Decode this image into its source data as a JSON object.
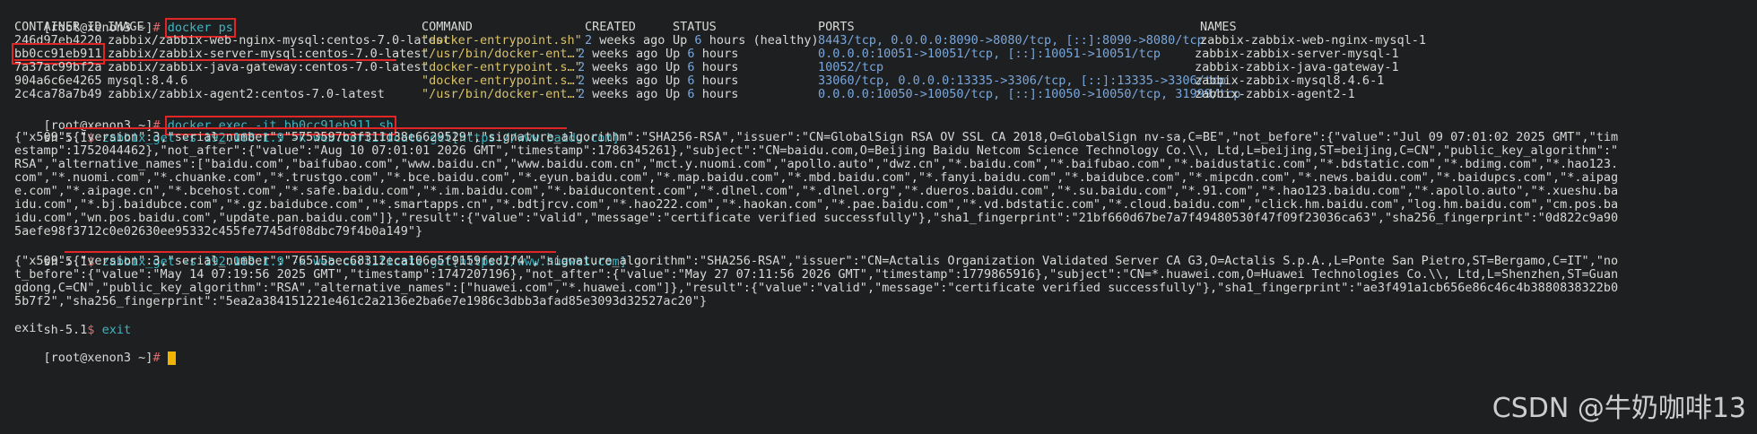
{
  "prompt": {
    "user_host": "[root@xenon3 ~]",
    "hash": "#"
  },
  "sh_prompt": {
    "text": "sh-5.1",
    "sign": "$"
  },
  "cmd_docker_ps": "docker ps",
  "header": {
    "container_id": "CONTAINER ID",
    "image": "IMAGE",
    "command": "COMMAND",
    "created": "CREATED",
    "status": "STATUS",
    "ports": "PORTS",
    "names": "NAMES"
  },
  "rows": [
    {
      "id": "246d97eb4220",
      "image": "zabbix/zabbix-web-nginx-mysql:centos-7.0-latest",
      "command": "\"docker-entrypoint.sh\"",
      "created_num": "2",
      "created": "weeks ago",
      "status_prefix": "Up",
      "status_num": "6",
      "status_rest": "hours (healthy)",
      "ports": "8443/tcp, 0.0.0.0:8090->8080/tcp, [::]:8090->8080/tcp",
      "name": "zabbix-zabbix-web-nginx-mysql-1"
    },
    {
      "id": "bb0cc91eb911",
      "image": "zabbix/zabbix-server-mysql:centos-7.0-latest",
      "command": "\"/usr/bin/docker-ent…\"",
      "created_num": "2",
      "created": "weeks ago",
      "status_prefix": "Up",
      "status_num": "6",
      "status_rest": "hours",
      "ports": "0.0.0.0:10051->10051/tcp, [::]:10051->10051/tcp",
      "name": "zabbix-zabbix-server-mysql-1"
    },
    {
      "id": "7a37ac99bf2a",
      "image": "zabbix/zabbix-java-gateway:centos-7.0-latest",
      "command": "\"docker-entrypoint.s…\"",
      "created_num": "2",
      "created": "weeks ago",
      "status_prefix": "Up",
      "status_num": "6",
      "status_rest": "hours",
      "ports": "10052/tcp",
      "name": "zabbix-zabbix-java-gateway-1"
    },
    {
      "id": "904a6c6e4265",
      "image": "mysql:8.4.6",
      "command": "\"docker-entrypoint.s…\"",
      "created_num": "2",
      "created": "weeks ago",
      "status_prefix": "Up",
      "status_num": "6",
      "status_rest": "hours",
      "ports": "33060/tcp, 0.0.0.0:13335->3306/tcp, [::]:13335->3306/tcp",
      "name": "zabbix-zabbix-mysql8.4.6-1"
    },
    {
      "id": "2c4ca78a7b49",
      "image": "zabbix/zabbix-agent2:centos-7.0-latest",
      "command": "\"/usr/bin/docker-ent…\"",
      "created_num": "2",
      "created": "weeks ago",
      "status_prefix": "Up",
      "status_num": "6",
      "status_rest": "hours",
      "ports": "0.0.0.0:10050->10050/tcp, [::]:10050->10050/tcp, 31999/tcp",
      "name": "zabbix-zabbix-agent2-1"
    }
  ],
  "cmd_exec": "docker exec -it bb0cc91eb911 sh",
  "zabbix_get_1": "zabbix_get -s 192.168.1.9 -k web.certificate.get[https://www.baidu.com]",
  "output_baidu": [
    "{\"x509\":{\"version\":3,\"serial_number\":\"5753597b3f311d38e6629529\",\"signature_algorithm\":\"SHA256-RSA\",\"issuer\":\"CN=GlobalSign RSA OV SSL CA 2018,O=GlobalSign nv-sa,C=BE\",\"not_before\":{\"value\":\"Jul 09 07:01:02 2025 GMT\",\"tim",
    "estamp\":1752044462},\"not_after\":{\"value\":\"Aug 10 07:01:01 2026 GMT\",\"timestamp\":1786345261},\"subject\":\"CN=baidu.com,O=Beijing Baidu Netcom Science Technology Co.\\\\, Ltd,L=beijing,ST=beijing,C=CN\",\"public_key_algorithm\":\"",
    "RSA\",\"alternative_names\":[\"baidu.com\",\"baifubao.com\",\"www.baidu.cn\",\"www.baidu.com.cn\",\"mct.y.nuomi.com\",\"apollo.auto\",\"dwz.cn\",\"*.baidu.com\",\"*.baifubao.com\",\"*.baidustatic.com\",\"*.bdstatic.com\",\"*.bdimg.com\",\"*.hao123.",
    "com\",\"*.nuomi.com\",\"*.chuanke.com\",\"*.trustgo.com\",\"*.bce.baidu.com\",\"*.eyun.baidu.com\",\"*.map.baidu.com\",\"*.mbd.baidu.com\",\"*.fanyi.baidu.com\",\"*.baidubce.com\",\"*.mipcdn.com\",\"*.news.baidu.com\",\"*.baidupcs.com\",\"*.aipag",
    "e.com\",\"*.aipage.cn\",\"*.bcehost.com\",\"*.safe.baidu.com\",\"*.im.baidu.com\",\"*.baiducontent.com\",\"*.dlnel.com\",\"*.dlnel.org\",\"*.dueros.baidu.com\",\"*.su.baidu.com\",\"*.91.com\",\"*.hao123.baidu.com\",\"*.apollo.auto\",\"*.xueshu.ba",
    "idu.com\",\"*.bj.baidubce.com\",\"*.gz.baidubce.com\",\"*.smartapps.cn\",\"*.bdtjrcv.com\",\"*.hao222.com\",\"*.haokan.com\",\"*.pae.baidu.com\",\"*.vd.bdstatic.com\",\"*.cloud.baidu.com\",\"click.hm.baidu.com\",\"log.hm.baidu.com\",\"cm.pos.ba",
    "idu.com\",\"wn.pos.baidu.com\",\"update.pan.baidu.com\"]},\"result\":{\"value\":\"valid\",\"message\":\"certificate verified successfully\"},\"sha1_fingerprint\":\"21bf660d67be7a7f49480530f47f09f23036ca63\",\"sha256_fingerprint\":\"0d822c9a90",
    "5aefe98f3712c0e02630ee95332c455fe7745df08dbc79f4b0a149\"}"
  ],
  "zabbix_get_2": "zabbix_get -s 192.168.1.9 -k web.certificate.get[https://www.huawei.com]",
  "output_huawei": [
    "{\"x509\":{\"version\":3,\"serial_number\":\"76515aec68312eca106e5f9159fed1f4\",\"signature_algorithm\":\"SHA256-RSA\",\"issuer\":\"CN=Actalis Organization Validated Server CA G3,O=Actalis S.p.A.,L=Ponte San Pietro,ST=Bergamo,C=IT\",\"no",
    "t_before\":{\"value\":\"May 14 07:19:56 2025 GMT\",\"timestamp\":1747207196},\"not_after\":{\"value\":\"May 27 07:11:56 2026 GMT\",\"timestamp\":1779865916},\"subject\":\"CN=*.huawei.com,O=Huawei Technologies Co.\\\\, Ltd,L=Shenzhen,ST=Guan",
    "gdong,C=CN\",\"public_key_algorithm\":\"RSA\",\"alternative_names\":[\"huawei.com\",\"*.huawei.com\"]},\"result\":{\"value\":\"valid\",\"message\":\"certificate verified successfully\"},\"sha1_fingerprint\":\"ae3f491a1cb656e86c46c4b3880838322b0",
    "5b7f2\",\"sha256_fingerprint\":\"5ea2a384151221e461c2a2136e2ba6e7e1986c3dbb3afad85e3093d32527ac20\"}"
  ],
  "cmd_exit": "exit",
  "exit_output": "exit",
  "watermark": "CSDN @牛奶咖啡13",
  "colors": {
    "background": "#1d1f21",
    "highlight_box": "#e02626",
    "prompt_sign": "#e06c6c",
    "command": "#3fb6c2",
    "cursor": "#f0b400"
  }
}
